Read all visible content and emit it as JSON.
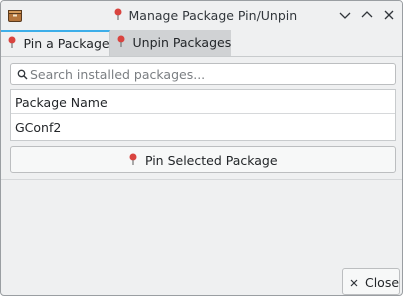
{
  "window": {
    "title": "Manage Package Pin/Unpin",
    "title_icon": "pin-icon",
    "app_icon": "package-box-icon",
    "controls": [
      "minimize",
      "maximize",
      "close"
    ]
  },
  "tabs": [
    {
      "label": "Pin a Package",
      "icon": "pin-icon",
      "active": true
    },
    {
      "label": "Unpin Packages",
      "icon": "pin-icon",
      "active": false
    }
  ],
  "search": {
    "placeholder": "Search installed packages...",
    "value": ""
  },
  "table": {
    "columns": [
      "Package Name"
    ],
    "rows": [
      [
        "GConf2"
      ]
    ]
  },
  "pin_button": {
    "label": "Pin Selected Package",
    "icon": "pin-icon"
  },
  "close_button": {
    "label": "Close",
    "icon": "close-x-icon"
  },
  "colors": {
    "accent": "#3daee9",
    "pin_red": "#d9443f",
    "window_bg": "#eff0f1"
  }
}
